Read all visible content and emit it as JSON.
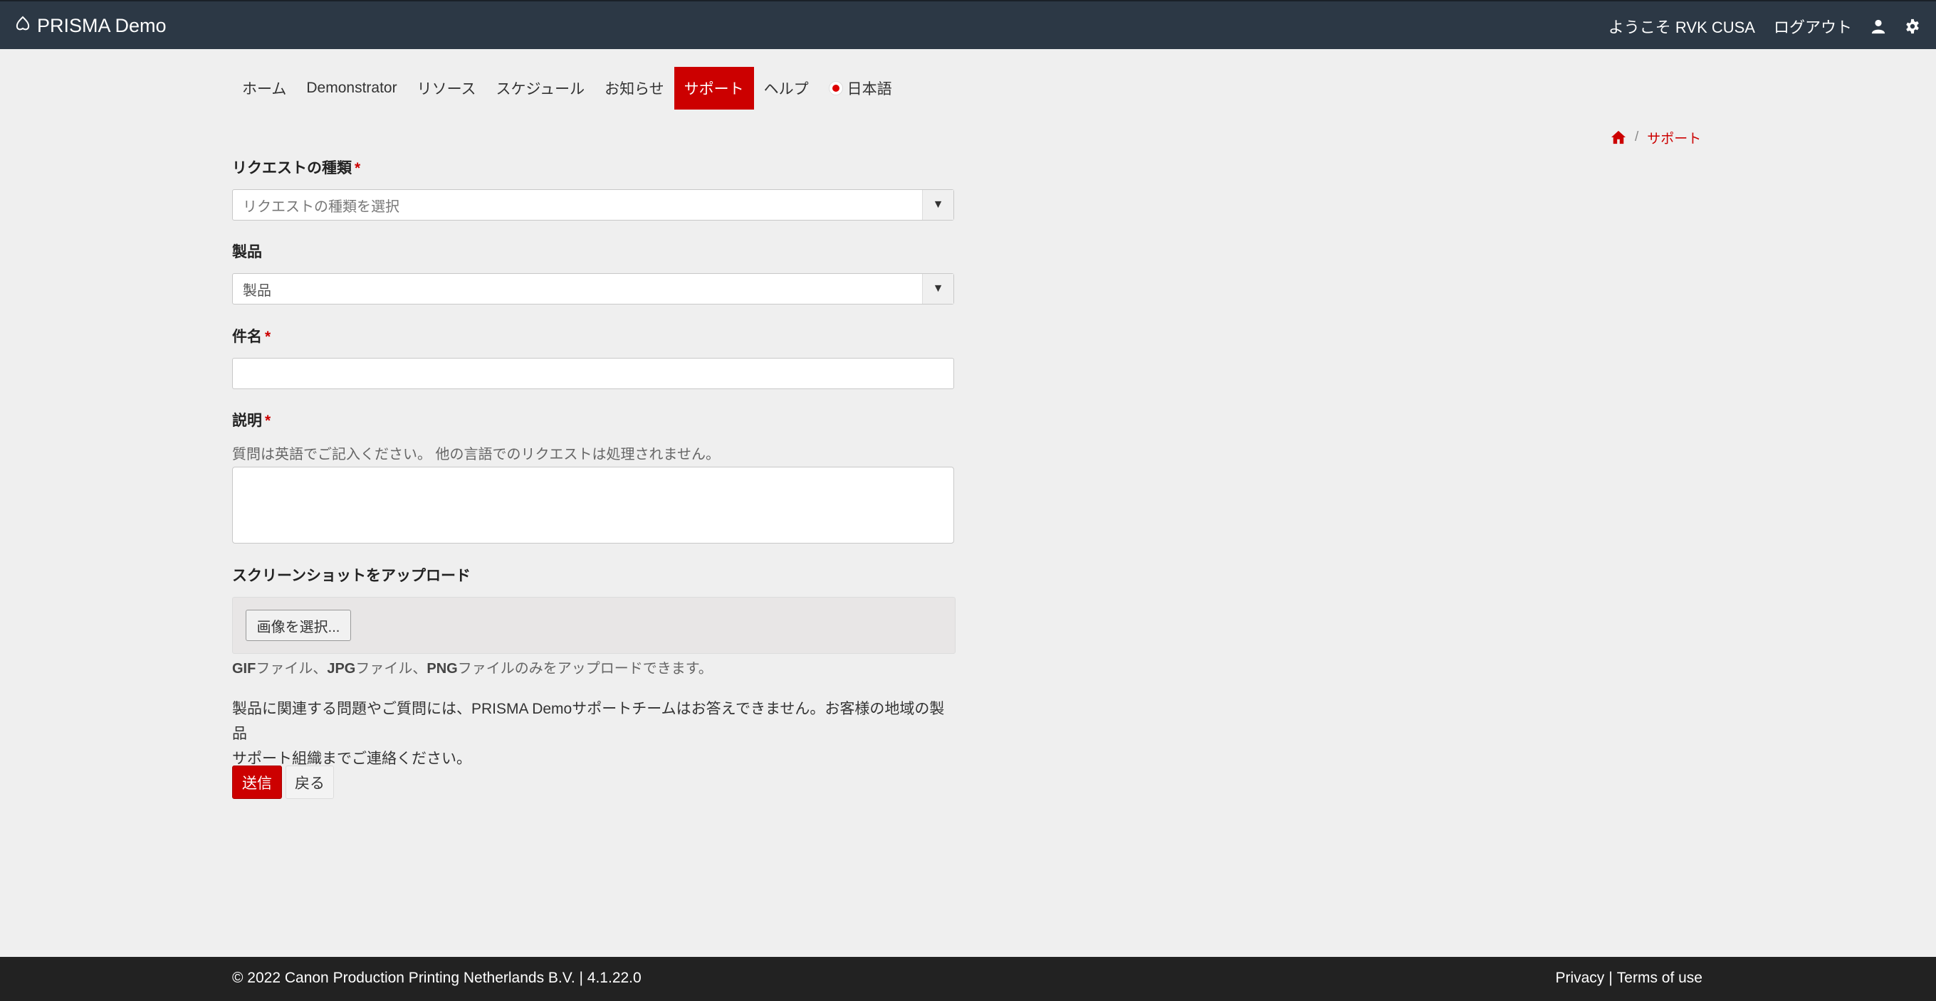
{
  "header": {
    "brand": "PRISMA Demo",
    "welcome": "ようこそ RVK CUSA",
    "logout": "ログアウト",
    "icons": [
      "logo-icon",
      "user-icon",
      "gear-icon"
    ]
  },
  "nav": {
    "items": [
      {
        "label": "ホーム"
      },
      {
        "label": "Demonstrator"
      },
      {
        "label": "リソース"
      },
      {
        "label": "スケジュール"
      },
      {
        "label": "お知らせ"
      },
      {
        "label": "サポート",
        "active": true
      },
      {
        "label": "ヘルプ"
      },
      {
        "label": "日本語",
        "icon": "japan-flag-icon"
      }
    ]
  },
  "breadcrumb": {
    "home_icon": "home-icon",
    "separator": "/",
    "current": "サポート"
  },
  "form": {
    "request_type": {
      "label": "リクエストの種類",
      "required_mark": "*",
      "value": "リクエストの種類を選択"
    },
    "product": {
      "label": "製品",
      "value": "製品"
    },
    "subject": {
      "label": "件名",
      "required_mark": "*",
      "value": ""
    },
    "description": {
      "label": "説明",
      "required_mark": "*",
      "help": "質問は英語でご記入ください。 他の言語でのリクエストは処理されません。",
      "value": ""
    },
    "upload": {
      "label": "スクリーンショットをアップロード",
      "button": "画像を選択...",
      "types": [
        "GIF",
        "JPG",
        "PNG"
      ],
      "type_text_1": "ファイル、",
      "type_text_2": "ファイル、",
      "type_text_3": "ファイルのみをアップロードできます。"
    },
    "notice_line1": "製品に関連する問題やご質問には、PRISMA Demoサポートチームはお答えできません。お客様の地域の製品",
    "notice_line2": "サポート組織までご連絡ください。",
    "submit": "送信",
    "back": "戻る"
  },
  "footer": {
    "copyright": "© 2022 Canon Production Printing Netherlands B.V. | 4.1.22.0",
    "privacy": "Privacy",
    "separator": "|",
    "terms": "Terms of use"
  },
  "colors": {
    "topbar": "#2c3845",
    "accent": "#cc0000",
    "footer": "#222222",
    "background": "#efefef"
  }
}
